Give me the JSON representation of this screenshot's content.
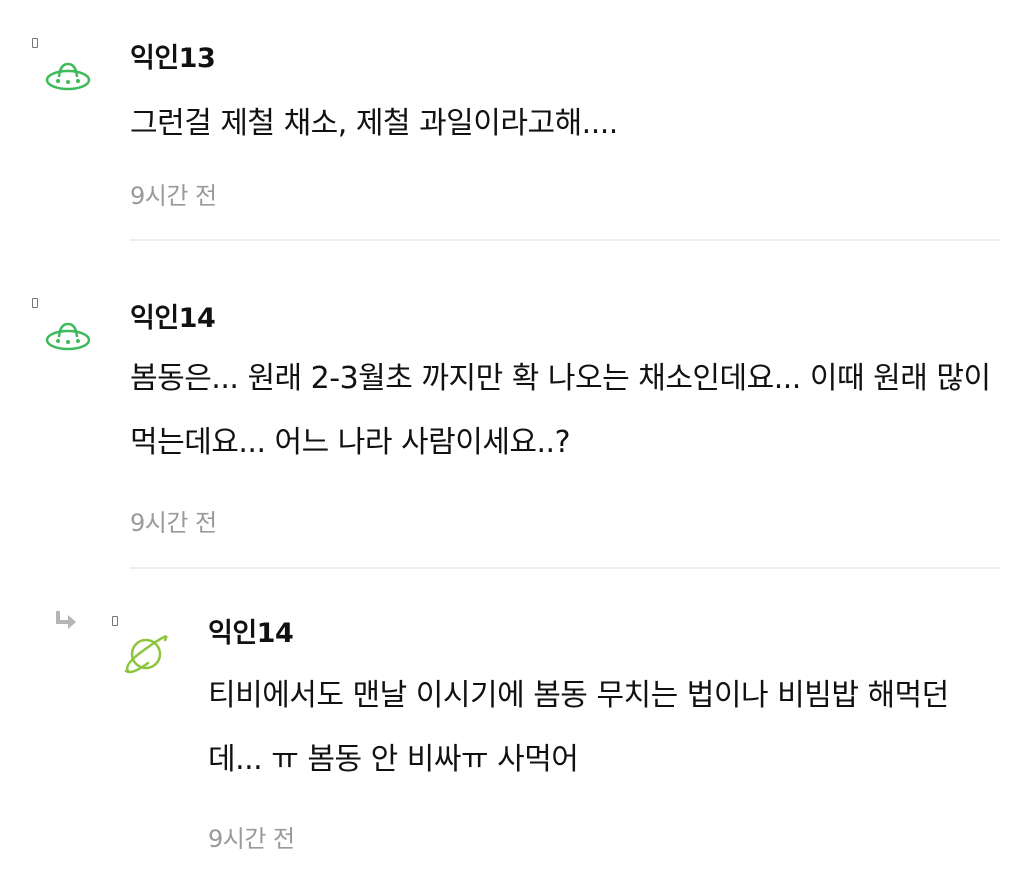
{
  "comments": [
    {
      "author": "익인13",
      "avatar_icon": "ufo-icon",
      "text": "그런걸 제철 채소, 제철 과일이라고해....",
      "time": "9시간 전",
      "is_reply": false
    },
    {
      "author": "익인14",
      "avatar_icon": "ufo-icon",
      "text": "봄동은... 원래 2-3월초 까지만 확 나오는 채소인데요... 이때 원래 많이 먹는데요... 어느 나라 사람이세요..?",
      "time": "9시간 전",
      "is_reply": false
    },
    {
      "author": "익인14",
      "avatar_icon": "planet-icon",
      "text": "티비에서도 맨날 이시기에 봄동 무치는 법이나 비빔밥 해먹던데... ㅠ 봄동 안 비싸ㅠ 사먹어",
      "time": "9시간 전",
      "is_reply": true
    }
  ],
  "colors": {
    "ufo_avatar": "#3dba5a",
    "planet_avatar": "#8cc63f",
    "reply_arrow": "#b5b5b5",
    "time_text": "#9a9a9a",
    "divider": "#eeeeee"
  }
}
